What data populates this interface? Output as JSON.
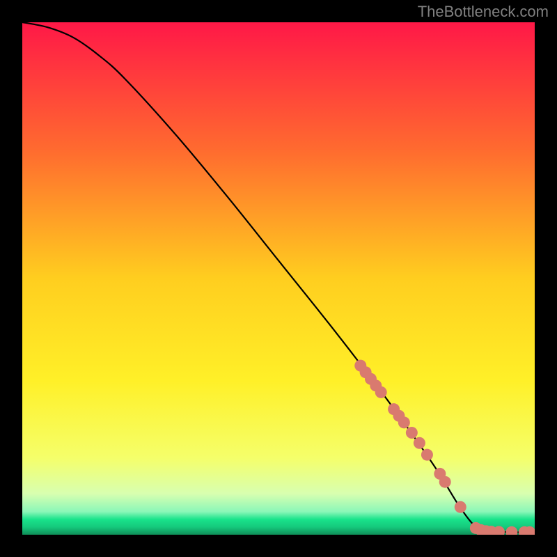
{
  "watermark": "TheBottleneck.com",
  "chart_data": {
    "type": "line",
    "title": "",
    "xlabel": "",
    "ylabel": "",
    "xlim": [
      0,
      100
    ],
    "ylim": [
      0,
      100
    ],
    "curve": [
      {
        "x": 0,
        "y": 100
      },
      {
        "x": 5,
        "y": 99
      },
      {
        "x": 10,
        "y": 97
      },
      {
        "x": 15,
        "y": 93.5
      },
      {
        "x": 20,
        "y": 89
      },
      {
        "x": 30,
        "y": 78
      },
      {
        "x": 40,
        "y": 66
      },
      {
        "x": 50,
        "y": 53.5
      },
      {
        "x": 60,
        "y": 41
      },
      {
        "x": 70,
        "y": 28
      },
      {
        "x": 80,
        "y": 14
      },
      {
        "x": 85,
        "y": 6
      },
      {
        "x": 88,
        "y": 2
      },
      {
        "x": 90,
        "y": 0.8
      },
      {
        "x": 95,
        "y": 0.5
      },
      {
        "x": 100,
        "y": 0.5
      }
    ],
    "dots": [
      {
        "x": 66,
        "y": 33
      },
      {
        "x": 67,
        "y": 31.7
      },
      {
        "x": 68,
        "y": 30.4
      },
      {
        "x": 69,
        "y": 29.1
      },
      {
        "x": 70,
        "y": 27.8
      },
      {
        "x": 72.5,
        "y": 24.5
      },
      {
        "x": 73.5,
        "y": 23.2
      },
      {
        "x": 74.5,
        "y": 21.9
      },
      {
        "x": 76,
        "y": 19.9
      },
      {
        "x": 77.5,
        "y": 17.9
      },
      {
        "x": 79,
        "y": 15.6
      },
      {
        "x": 81.5,
        "y": 11.9
      },
      {
        "x": 82.5,
        "y": 10.3
      },
      {
        "x": 85.5,
        "y": 5.4
      },
      {
        "x": 88.5,
        "y": 1.3
      },
      {
        "x": 89.5,
        "y": 0.9
      },
      {
        "x": 90.5,
        "y": 0.7
      },
      {
        "x": 91.5,
        "y": 0.6
      },
      {
        "x": 93,
        "y": 0.55
      },
      {
        "x": 95.5,
        "y": 0.5
      },
      {
        "x": 98,
        "y": 0.5
      },
      {
        "x": 99,
        "y": 0.5
      }
    ],
    "gradient_stops": [
      {
        "offset": 0,
        "color": "#ff1847"
      },
      {
        "offset": 0.25,
        "color": "#ff6b2f"
      },
      {
        "offset": 0.5,
        "color": "#ffce1f"
      },
      {
        "offset": 0.7,
        "color": "#fff028"
      },
      {
        "offset": 0.85,
        "color": "#f5ff6a"
      },
      {
        "offset": 0.92,
        "color": "#d8ffb0"
      },
      {
        "offset": 0.955,
        "color": "#8bf7b8"
      },
      {
        "offset": 0.97,
        "color": "#19e38b"
      },
      {
        "offset": 0.985,
        "color": "#15c97c"
      },
      {
        "offset": 1.0,
        "color": "#0f8f58"
      }
    ],
    "dot_color": "#d97a6f",
    "line_color": "#000000"
  }
}
